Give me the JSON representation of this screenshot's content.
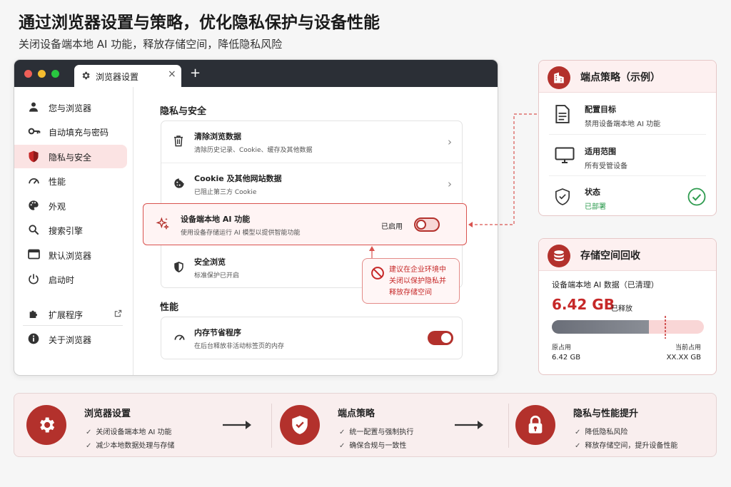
{
  "header": {
    "title": "通过浏览器设置与策略，优化隐私保护与设备性能",
    "subtitle": "关闭设备端本地 AI 功能，释放存储空间，降低隐私风险"
  },
  "browser": {
    "tab_title": "浏览器设置",
    "tab_close": "×",
    "new_tab": "+",
    "sidebar": [
      {
        "label": "您与浏览器",
        "icon": "person-icon"
      },
      {
        "label": "自动填充与密码",
        "icon": "key-icon"
      },
      {
        "label": "隐私与安全",
        "icon": "shield-icon",
        "active": true
      },
      {
        "label": "性能",
        "icon": "gauge-icon"
      },
      {
        "label": "外观",
        "icon": "palette-icon"
      },
      {
        "label": "搜索引擎",
        "icon": "search-icon"
      },
      {
        "label": "默认浏览器",
        "icon": "browser-icon"
      },
      {
        "label": "启动时",
        "icon": "power-icon"
      },
      {
        "label": "扩展程序",
        "icon": "puzzle-icon",
        "external": true
      },
      {
        "label": "关于浏览器",
        "icon": "info-icon"
      }
    ],
    "privacy": {
      "heading": "隐私与安全",
      "clear_data": {
        "title": "清除浏览数据",
        "desc": "清除历史记录、Cookie、缓存及其他数据"
      },
      "cookies": {
        "title": "Cookie 及其他网站数据",
        "desc": "已阻止第三方 Cookie"
      },
      "local_ai": {
        "title": "设备端本地 AI 功能",
        "desc": "使用设备存储运行 AI 模型以提供智能功能",
        "status": "已启用",
        "enabled": false
      },
      "safe_browsing": {
        "title": "安全浏览",
        "desc": "标准保护已开启"
      }
    },
    "performance": {
      "heading": "性能",
      "memory_saver": {
        "title": "内存节省程序",
        "desc": "在后台释放非活动标签页的内存",
        "enabled": true
      }
    },
    "callout": "建议在企业环境中\n关闭以保护隐私并\n释放存储空间"
  },
  "policy_panel": {
    "title": "端点策略（示例）",
    "items": [
      {
        "label": "配置目标",
        "value": "禁用设备端本地 AI 功能"
      },
      {
        "label": "适用范围",
        "value": "所有受管设备"
      },
      {
        "label": "状态",
        "value": "已部署"
      }
    ]
  },
  "storage_panel": {
    "title": "存储空间回收",
    "subtitle": "设备端本地 AI 数据（已清理）",
    "amount": "6.42 GB",
    "amount_suffix": "已释放",
    "freed_fraction": 0.64,
    "left_label": "原占用",
    "left_value": "6.42 GB",
    "right_label": "当前占用",
    "right_value": "XX.XX GB"
  },
  "bottom": {
    "steps": [
      {
        "title": "浏览器设置",
        "lines": [
          "关闭设备端本地 AI 功能",
          "减少本地数据处理与存储"
        ]
      },
      {
        "title": "端点策略",
        "lines": [
          "统一配置与强制执行",
          "确保合规与一致性"
        ]
      },
      {
        "title": "隐私与性能提升",
        "lines": [
          "降低隐私风险",
          "释放存储空间，提升设备性能"
        ]
      }
    ],
    "check": "✓"
  },
  "colors": {
    "accent": "#b3312c",
    "accent_light": "#fbe3e3",
    "success": "#2e9b4f",
    "tabbar": "#2b2f36"
  }
}
